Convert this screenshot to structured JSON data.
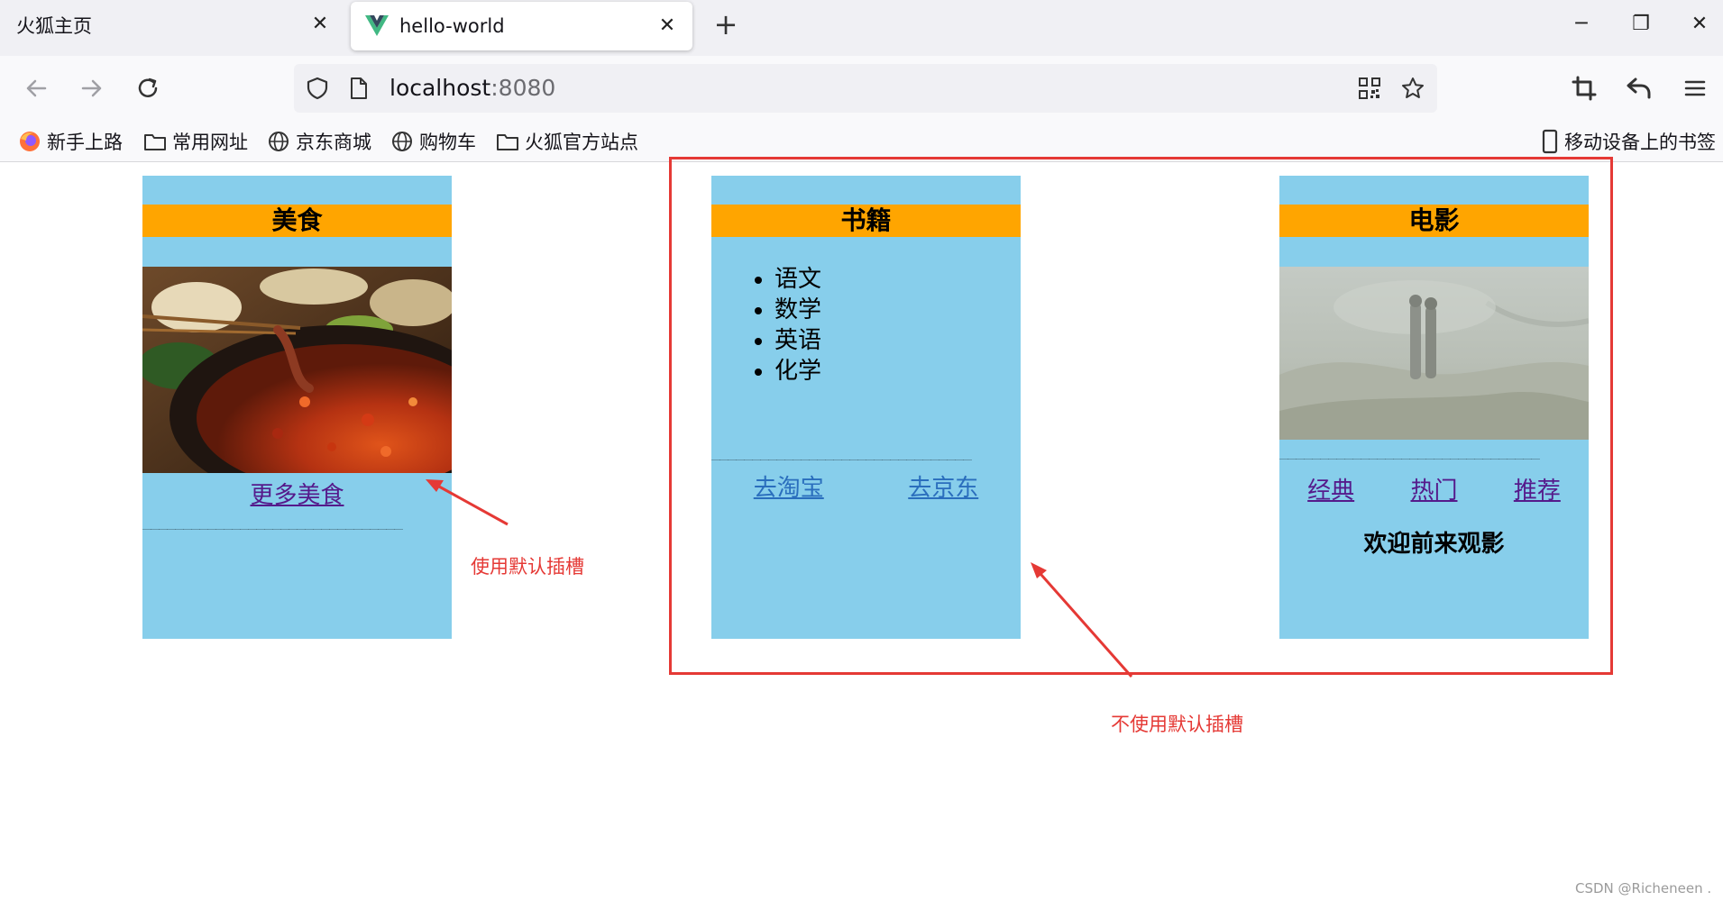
{
  "browser": {
    "tabs": [
      {
        "title": "火狐主页",
        "active": false
      },
      {
        "title": "hello-world",
        "active": true
      }
    ],
    "url": {
      "host": "localhost",
      "port": ":8080"
    },
    "bookmarks": [
      {
        "label": "新手上路",
        "icon": "firefox-icon"
      },
      {
        "label": "常用网址",
        "icon": "folder-icon"
      },
      {
        "label": "京东商城",
        "icon": "globe-icon"
      },
      {
        "label": "购物车",
        "icon": "globe-icon"
      },
      {
        "label": "火狐官方站点",
        "icon": "folder-icon"
      }
    ],
    "mobile_bookmarks": "移动设备上的书签"
  },
  "page": {
    "food": {
      "title": "美食",
      "link": "更多美食",
      "dashes": "________________________________"
    },
    "books": {
      "title": "书籍",
      "items": [
        "语文",
        "数学",
        "英语",
        "化学"
      ],
      "dashes": "________________________________",
      "links": [
        "去淘宝",
        "去京东"
      ]
    },
    "movies": {
      "title": "电影",
      "dashes": "________________________________",
      "links": [
        "经典",
        "热门",
        "推荐"
      ],
      "welcome": "欢迎前来观影"
    }
  },
  "annotations": {
    "default_slot": "使用默认插槽",
    "no_default_slot": "不使用默认插槽"
  },
  "watermark": "CSDN @Richeneen .",
  "colors": {
    "panel_bg": "#87ceeb",
    "title_bg": "#ffa500",
    "annotation": "#e53935"
  }
}
